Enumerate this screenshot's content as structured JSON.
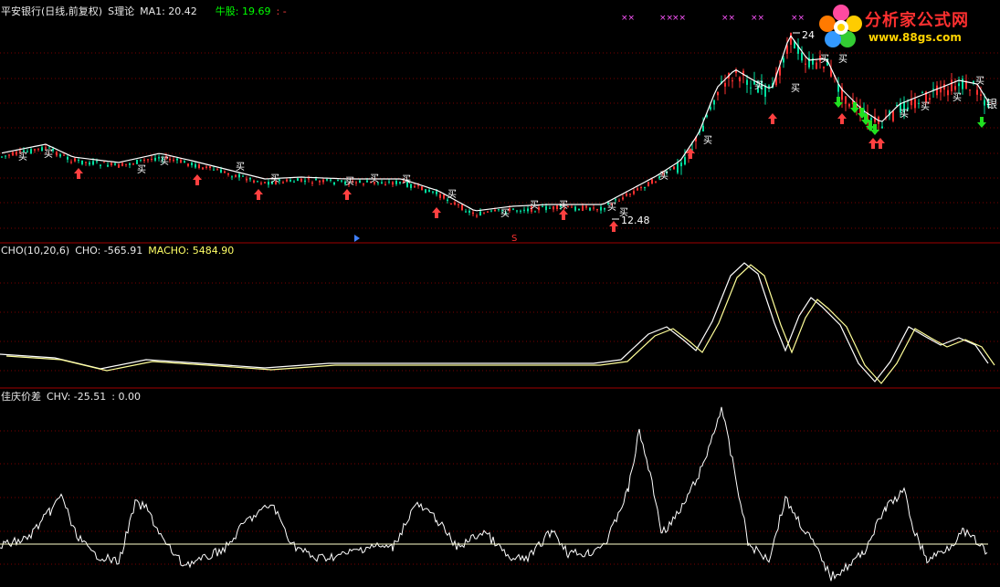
{
  "panel1": {
    "title": "平安银行(日线,前复权)",
    "indicator": "S理论",
    "ma_label": "MA1: 20.42",
    "bull_label": "牛股: 19.69",
    "bull_suffix": ":  -",
    "high_label": "24",
    "low_label": "12.48",
    "buy_char": "买",
    "edge_char": "银",
    "s_marker": "S"
  },
  "panel2": {
    "title": "CHO(10,20,6)",
    "cho": "CHO: -565.91",
    "macho": "MACHO: 5484.90"
  },
  "panel3": {
    "title": "佳庆价差",
    "chv": "CHV: -25.51",
    "extra": ": 0.00"
  },
  "logo": {
    "name": "分析家公式网",
    "url": "www.88gs.com"
  },
  "colors": {
    "background": "#000000",
    "up": "#ff3030",
    "down": "#00e0a0",
    "ma": "#ffffff",
    "grid": "#7a0000",
    "separator": "#a00000",
    "cho_line": "#ffffff",
    "macho_line": "#ffff99"
  }
}
